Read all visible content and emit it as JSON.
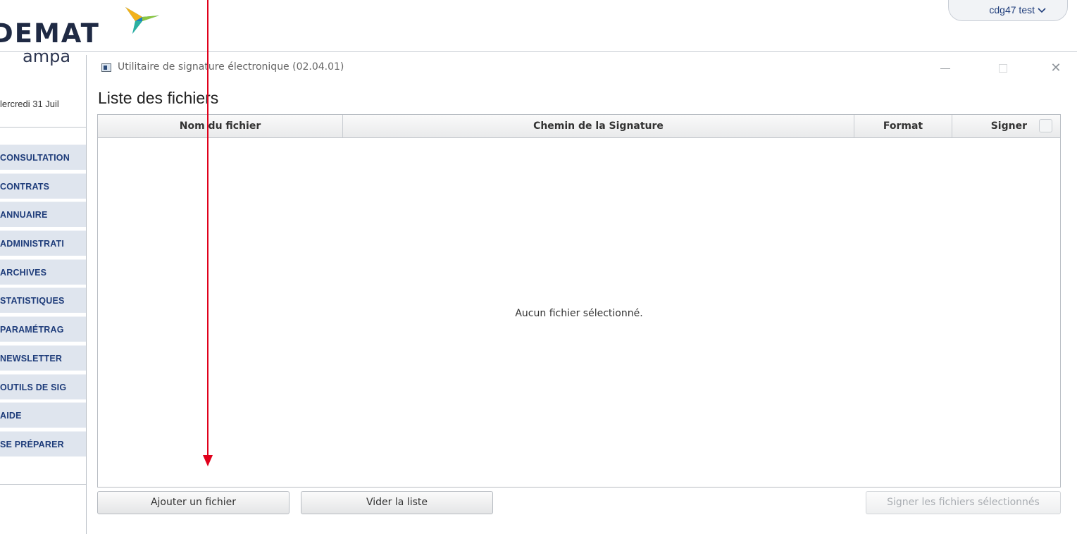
{
  "background_page": {
    "logo": {
      "word": "DEMAT",
      "sub": "ampa"
    },
    "user_menu": {
      "label": "cdg47 test"
    },
    "date": "lercredi 31 Juil",
    "nav_items": [
      "CONSULTATION",
      "CONTRATS",
      "ANNUAIRE",
      "ADMINISTRATI",
      "ARCHIVES",
      "STATISTIQUES",
      "PARAMÉTRAG",
      "NEWSLETTER",
      "OUTILS DE SIG",
      "AIDE",
      "SE PRÉPARER"
    ]
  },
  "dialog": {
    "window_title": "Utilitaire de signature électronique (02.04.01)",
    "heading": "Liste des fichiers",
    "columns": {
      "name": "Nom du fichier",
      "path": "Chemin de la Signature",
      "format": "Format",
      "sign": "Signer"
    },
    "empty_message": "Aucun fichier sélectionné.",
    "buttons": {
      "add_file": "Ajouter un fichier",
      "clear_list": "Vider la liste",
      "sign_selected": "Signer les fichiers sélectionnés"
    }
  },
  "annotation": {
    "arrow_color": "#e0001b"
  },
  "colors": {
    "nav_text": "#1e3c7a",
    "nav_bg": "#dfe5ee",
    "accent_red": "#e0001b"
  }
}
